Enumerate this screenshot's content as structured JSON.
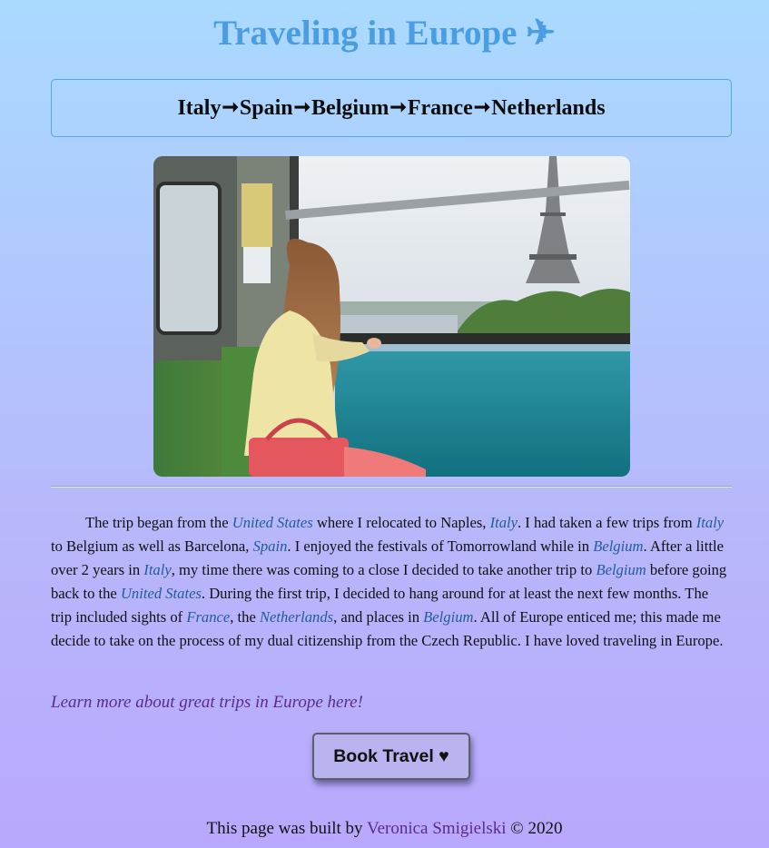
{
  "header": {
    "title": "Traveling in Europe ✈"
  },
  "route": {
    "stops": [
      "Italy",
      "Spain",
      "Belgium",
      "France",
      "Netherlands"
    ],
    "separator": "➞"
  },
  "story": {
    "segments": [
      {
        "t": "The trip began from the "
      },
      {
        "t": "United States",
        "place": true
      },
      {
        "t": " where I relocated to Naples, "
      },
      {
        "t": "Italy",
        "place": true
      },
      {
        "t": ". I had taken a few trips from "
      },
      {
        "t": "Italy",
        "place": true
      },
      {
        "t": " to Belgium as well as Barcelona, "
      },
      {
        "t": "Spain",
        "place": true
      },
      {
        "t": ". I enjoyed the festivals of Tomorrowland while in "
      },
      {
        "t": "Belgium",
        "place": true
      },
      {
        "t": ". After a little over 2 years in "
      },
      {
        "t": "Italy",
        "place": true
      },
      {
        "t": ", my time there was coming to a close I decided to take another trip to "
      },
      {
        "t": "Belgium",
        "place": true
      },
      {
        "t": " before going back to the "
      },
      {
        "t": "United States",
        "place": true
      },
      {
        "t": ". During the first trip, I decided to hang around for at least the next few months. The trip included sights of "
      },
      {
        "t": "France",
        "place": true
      },
      {
        "t": ", the "
      },
      {
        "t": "Netherlands",
        "place": true
      },
      {
        "t": ", and places in "
      },
      {
        "t": "Belgium",
        "place": true
      },
      {
        "t": ". All of Europe enticed me; this made me decide to take on the process of my dual citizenship from the Czech Republic. I have loved traveling in Europe."
      }
    ]
  },
  "links": {
    "learn_more": "Learn more about great trips in Europe here!"
  },
  "actions": {
    "book_label": "Book Travel ♥"
  },
  "footer": {
    "prefix": "This page was built by ",
    "author": "Veronica Smigielski",
    "suffix": " © 2020"
  },
  "colors": {
    "title": "#4a9de2",
    "place_link": "#1f5c99",
    "visited_link": "#5b2d84",
    "button_bg": "#b9b3ef"
  }
}
